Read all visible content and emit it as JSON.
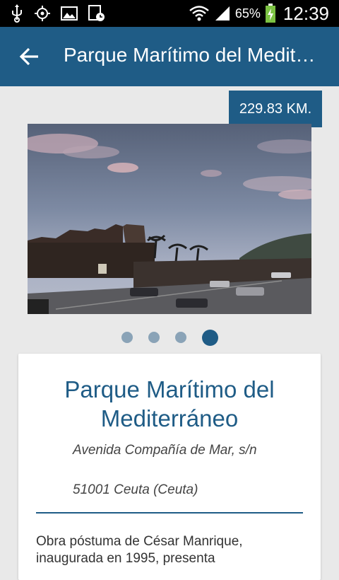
{
  "status_bar": {
    "battery_percent": "65%",
    "time": "12:39",
    "icons": [
      "usb-icon",
      "gps-icon",
      "gallery-icon",
      "screenshot-icon",
      "wifi-icon",
      "signal-icon",
      "battery-icon"
    ]
  },
  "app_bar": {
    "title": "Parque Marítimo del Medit…",
    "back_icon": "arrow-left-icon"
  },
  "distance_badge": "229.83 KM.",
  "gallery": {
    "page_count": 4,
    "active_page": 4
  },
  "card": {
    "title": "Parque Marítimo del Mediterráneo",
    "address_line1": "Avenida Compañía de Mar, s/n",
    "address_line2": "51001 Ceuta (Ceuta)",
    "description": "Obra póstuma de César Manrique, inaugurada en 1995, presenta"
  },
  "colors": {
    "primary": "#1f5c86",
    "background": "#e9e9e9",
    "card": "#ffffff"
  }
}
